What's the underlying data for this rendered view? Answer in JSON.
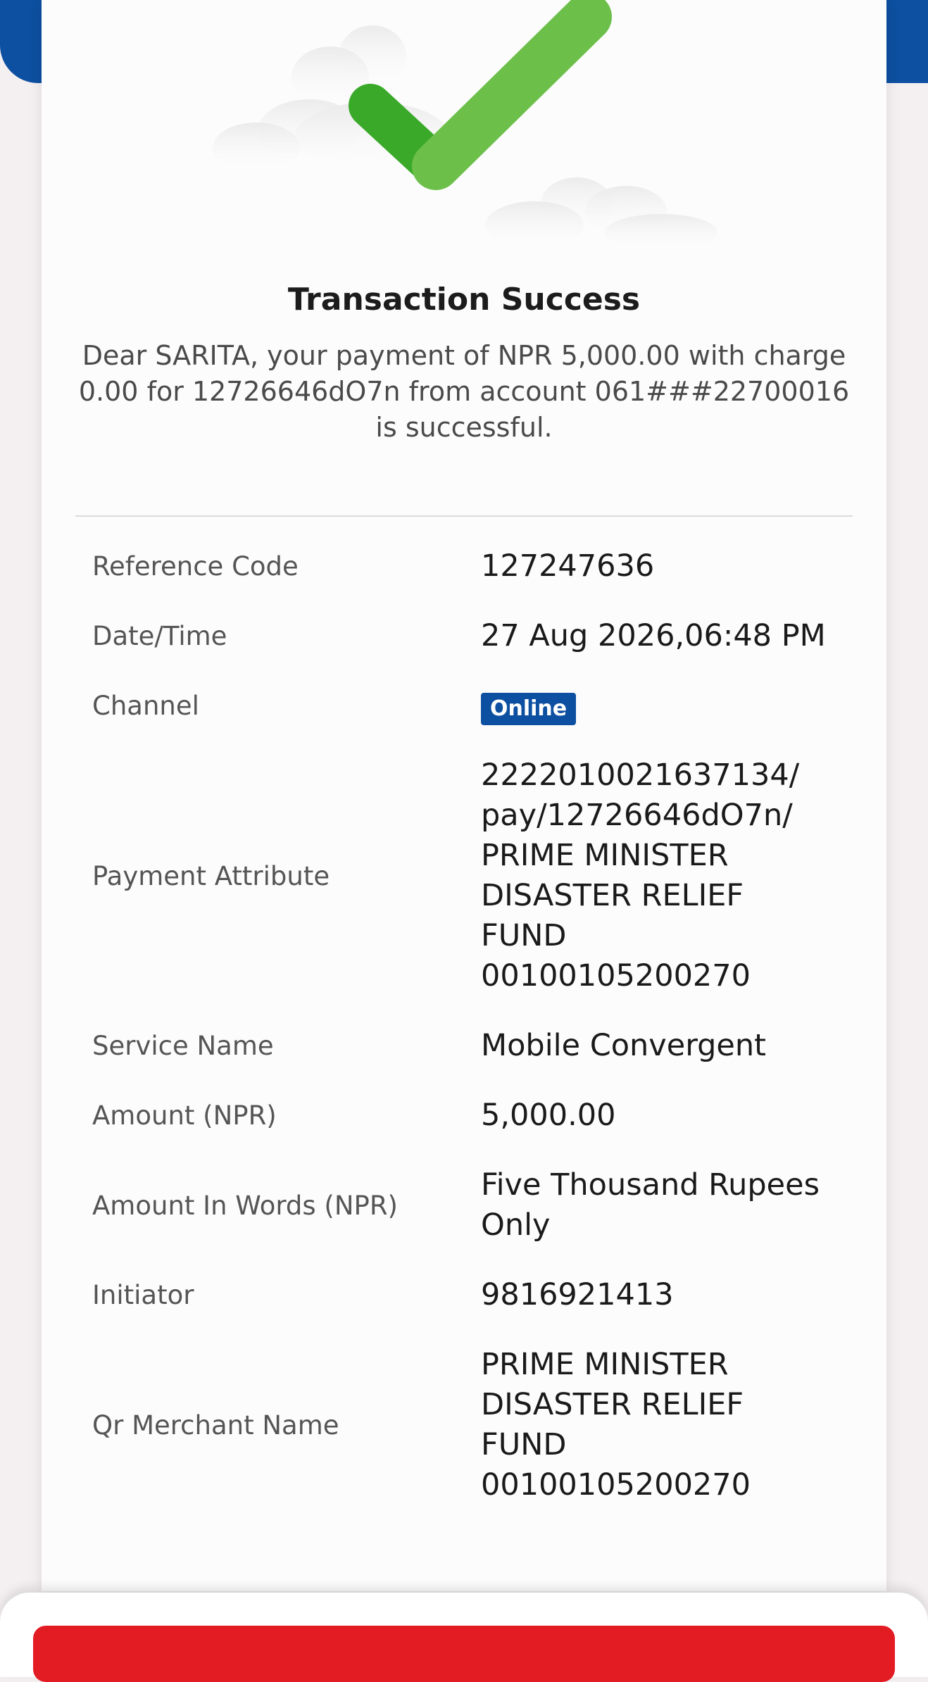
{
  "colors": {
    "brand_blue": "#0d4fa0",
    "success_green": "#6cc04a",
    "success_green_dark": "#3aa92a",
    "action_red": "#e31b23"
  },
  "header": {
    "title": "Transaction Success",
    "message": "Dear SARITA, your payment of NPR 5,000.00 with charge 0.00 for 12726646dO7n from account 061###22700016 is successful."
  },
  "details": [
    {
      "label": "Reference Code",
      "value": "127247636"
    },
    {
      "label": "Date/Time",
      "value": "27 Aug 2026,06:48 PM"
    },
    {
      "label": "Channel",
      "value": "Online"
    },
    {
      "label": "Payment Attribute",
      "value": "2222010021637134/\npay/12726646dO7n/\nPRIME MINISTER\nDISASTER RELIEF\nFUND\n00100105200270"
    },
    {
      "label": "Service Name",
      "value": "Mobile Convergent"
    },
    {
      "label": "Amount (NPR)",
      "value": "5,000.00"
    },
    {
      "label": "Amount In Words (NPR)",
      "value": "Five Thousand Rupees\nOnly"
    },
    {
      "label": "Initiator",
      "value": "9816921413"
    },
    {
      "label": "Qr Merchant Name",
      "value": "PRIME MINISTER\nDISASTER RELIEF\nFUND\n00100105200270"
    }
  ],
  "icons": {
    "success": "checkmark-icon",
    "decoration": "cloud-icon"
  }
}
